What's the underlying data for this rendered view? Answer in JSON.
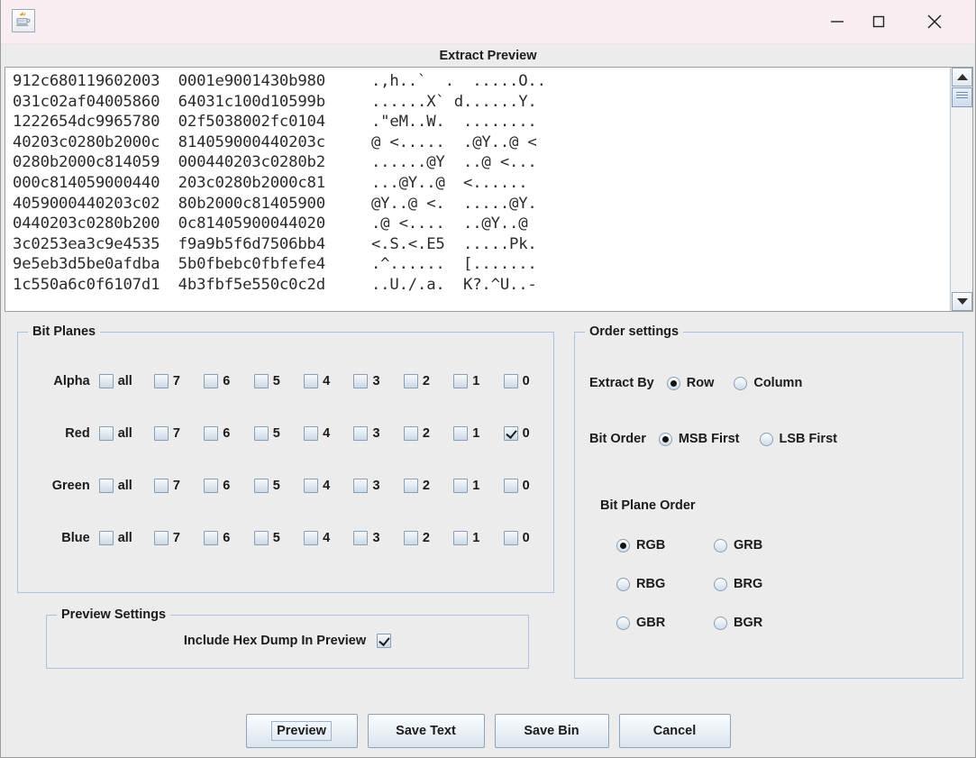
{
  "window": {
    "app_icon": "java-coffee-cup-icon",
    "title": "Extract Preview",
    "controls": {
      "minimize": "—",
      "maximize": "□",
      "close": "✕"
    }
  },
  "hex_preview": {
    "lines": [
      "912c680119602003  0001e9001430b980     .,h..`  .  .....O..",
      "031c02af04005860  64031c100d10599b     ......X` d......Y.",
      "1222654dc9965780  02f5038002fc0104     .\"eM..W.  ........",
      "40203c0280b2000c  814059000440203c     @ <.....  .@Y..@ <",
      "0280b2000c814059  000440203c0280b2     ......@Y  ..@ <...",
      "000c814059000440  203c0280b2000c81     ...@Y..@  <......",
      "4059000440203c02  80b2000c81405900     @Y..@ <.  .....@Y.",
      "0440203c0280b200  0c81405900044020     .@ <....  ..@Y..@",
      "3c0253ea3c9e4535  f9a9b5f6d7506bb4     <.S.<.E5  .....Pk.",
      "9e5eb3d5be0afdba  5b0fbebc0fbfefe4     .^......  [.......",
      "1c550a6c0f6107d1  4b3fbf5e550c0c2d     ..U./.a.  K?.^U..-"
    ],
    "scrollbar": {
      "up_arrow": "scroll-up-icon",
      "down_arrow": "scroll-down-icon"
    }
  },
  "bit_planes": {
    "title": "Bit Planes",
    "columns": [
      "all",
      "7",
      "6",
      "5",
      "4",
      "3",
      "2",
      "1",
      "0"
    ],
    "rows": [
      {
        "label": "Alpha",
        "checked": [
          false,
          false,
          false,
          false,
          false,
          false,
          false,
          false,
          false
        ]
      },
      {
        "label": "Red",
        "checked": [
          false,
          false,
          false,
          false,
          false,
          false,
          false,
          false,
          true
        ]
      },
      {
        "label": "Green",
        "checked": [
          false,
          false,
          false,
          false,
          false,
          false,
          false,
          false,
          false
        ]
      },
      {
        "label": "Blue",
        "checked": [
          false,
          false,
          false,
          false,
          false,
          false,
          false,
          false,
          false
        ]
      }
    ]
  },
  "order_settings": {
    "title": "Order settings",
    "extract_by": {
      "label": "Extract By",
      "options": [
        "Row",
        "Column"
      ],
      "selected": "Row"
    },
    "bit_order": {
      "label": "Bit Order",
      "options": [
        "MSB First",
        "LSB First"
      ],
      "selected": "MSB First"
    },
    "bit_plane_order": {
      "label": "Bit Plane Order",
      "options": [
        "RGB",
        "GRB",
        "RBG",
        "BRG",
        "GBR",
        "BGR"
      ],
      "selected": "RGB"
    }
  },
  "preview_settings": {
    "title": "Preview Settings",
    "include_hex_dump": {
      "label": "Include Hex Dump In Preview",
      "checked": true
    }
  },
  "buttons": [
    {
      "name": "preview",
      "label": "Preview",
      "focused": true
    },
    {
      "name": "save-text",
      "label": "Save Text",
      "focused": false
    },
    {
      "name": "save-bin",
      "label": "Save Bin",
      "focused": false
    },
    {
      "name": "cancel",
      "label": "Cancel",
      "focused": false
    }
  ],
  "colors": {
    "titlebar": "#f8eef2",
    "panel_bg": "#ececec",
    "group_border": "#a9c3dc",
    "text": "#1b1b1b",
    "hex_bg": "#ffffff",
    "control_accent": "#8a9eb4"
  }
}
